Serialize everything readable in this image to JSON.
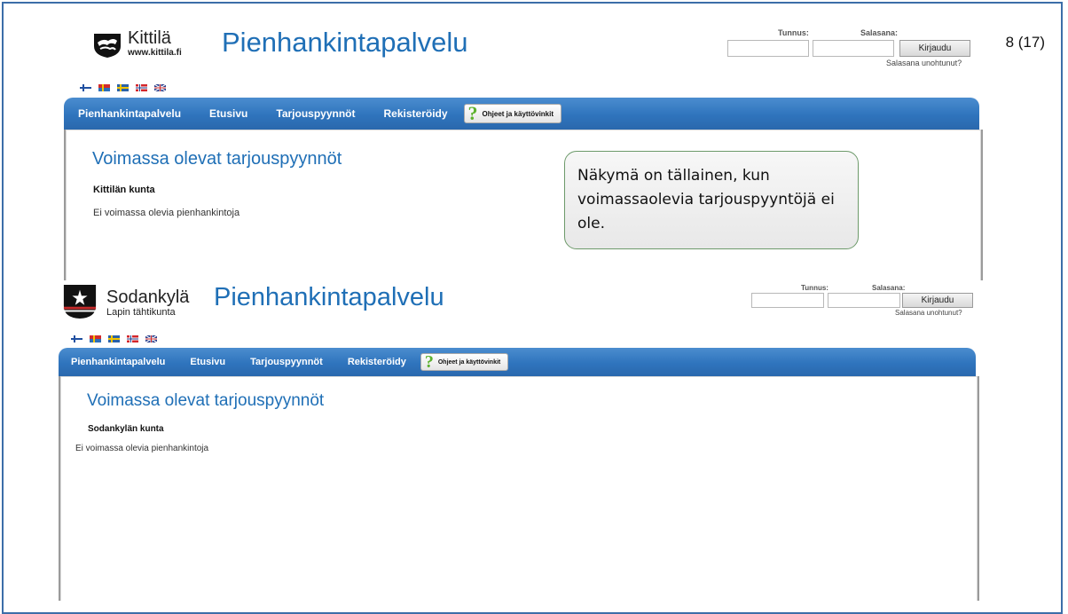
{
  "page_number": "8 (17)",
  "callout_text": "Näkymä on tällainen, kun voimassaolevia tarjouspyyntöjä ei ole.",
  "shot1": {
    "logo": {
      "name": "Kittilä",
      "sub": "www.kittila.fi"
    },
    "service_title": "Pienhankintapalvelu",
    "login": {
      "username_label": "Tunnus:",
      "password_label": "Salasana:",
      "button": "Kirjaudu",
      "forgot": "Salasana unohtunut?"
    },
    "nav": [
      "Pienhankintapalvelu",
      "Etusivu",
      "Tarjouspyynnöt",
      "Rekisteröidy"
    ],
    "help_button": "Ohjeet ja käyttövinkit",
    "content": {
      "heading": "Voimassa olevat tarjouspyynnöt",
      "org": "Kittilän kunta",
      "empty": "Ei voimassa olevia pienhankintoja"
    }
  },
  "shot2": {
    "logo": {
      "name": "Sodankylä",
      "sub": "Lapin tähtikunta"
    },
    "service_title": "Pienhankintapalvelu",
    "login": {
      "username_label": "Tunnus:",
      "password_label": "Salasana:",
      "button": "Kirjaudu",
      "forgot": "Salasana unohtunut?"
    },
    "nav": [
      "Pienhankintapalvelu",
      "Etusivu",
      "Tarjouspyynnöt",
      "Rekisteröidy"
    ],
    "help_button": "Ohjeet ja käyttövinkit",
    "content": {
      "heading": "Voimassa olevat tarjouspyynnöt",
      "org": "Sodankylän kunta",
      "empty": "Ei voimassa olevia pienhankintoja"
    }
  },
  "flags": [
    {
      "name": "finnish-flag-icon",
      "bg": "#ffffff",
      "cross": "#1f4fa0"
    },
    {
      "name": "sami-flag-icon",
      "bg": "#2d6fb8",
      "cross": "#d32b2b"
    },
    {
      "name": "swedish-flag-icon",
      "bg": "#2a62a8",
      "cross": "#f2c400"
    },
    {
      "name": "norwegian-flag-icon",
      "bg": "#d3262b",
      "cross": "#ffffff"
    },
    {
      "name": "uk-flag-icon",
      "bg": "#2a3f8c",
      "cross": "#ffffff"
    }
  ]
}
